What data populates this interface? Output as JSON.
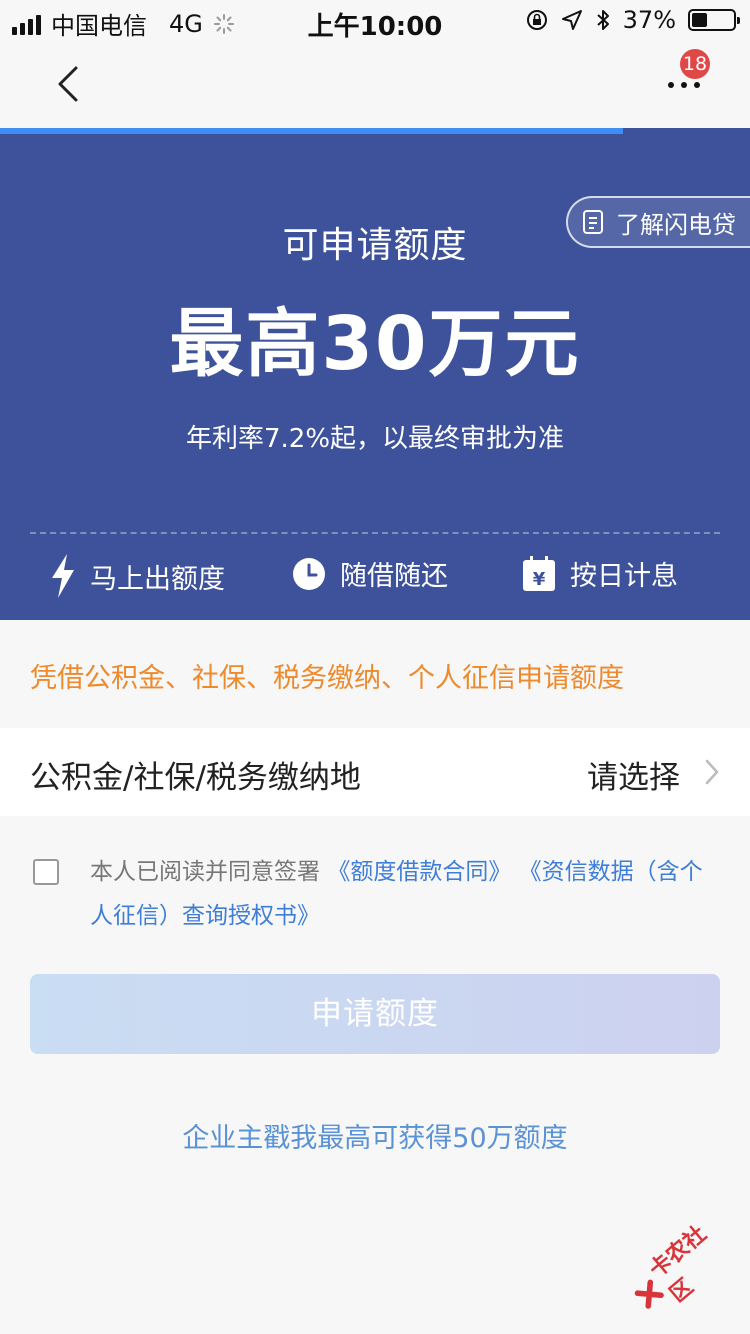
{
  "status_bar": {
    "carrier": "中国电信",
    "network": "4G",
    "time": "上午10:00",
    "battery": "37%",
    "battery_level": 0.37
  },
  "nav": {
    "badge_count": "18"
  },
  "progress": {
    "value": 0.83
  },
  "hero": {
    "subtitle": "可申请额度",
    "amount": "最高30万元",
    "rate": "年利率7.2%起，以最终审批为准",
    "learn_more": "了解闪电贷",
    "features": [
      {
        "label": "马上出额度",
        "icon": "lightning-icon"
      },
      {
        "label": "随借随还",
        "icon": "clock-icon"
      },
      {
        "label": "按日计息",
        "icon": "calendar-yen-icon"
      }
    ]
  },
  "notice": "凭借公积金、社保、税务缴纳、个人征信申请额度",
  "region": {
    "label": "公积金/社保/税务缴纳地",
    "value": "请选择"
  },
  "agreement": {
    "prefix": "本人已阅读并同意签署",
    "link1": "《额度借款合同》",
    "link2": "《资信数据（含个人征信）查询授权书》",
    "checked": false
  },
  "apply_button": "申请额度",
  "enterprise_link": "企业主戳我最高可获得50万额度",
  "watermark": "卡农社区",
  "colors": {
    "hero_bg": "#3e529b",
    "accent_orange": "#ee8a2e",
    "link_blue": "#3e7ed8",
    "badge_red": "#e04848"
  }
}
